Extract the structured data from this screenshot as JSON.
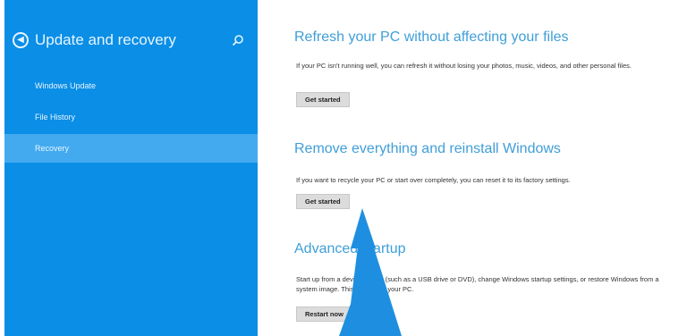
{
  "sidebar": {
    "title": "Update and recovery",
    "back_icon": "back-arrow-circle-icon",
    "search_icon": "search-icon",
    "items": [
      {
        "label": "Windows Update",
        "selected": false
      },
      {
        "label": "File History",
        "selected": false
      },
      {
        "label": "Recovery",
        "selected": true
      }
    ],
    "background_color": "#0a8ee6",
    "selected_color": "#43aaf0"
  },
  "main": {
    "sections": [
      {
        "title": "Refresh your PC without affecting your files",
        "description": "If your PC isn't running well, you can refresh it without losing your photos, music, videos, and other personal files.",
        "button_label": "Get started"
      },
      {
        "title": "Remove everything and reinstall Windows",
        "description": "If you want to recycle your PC or start over completely, you can reset it to its factory settings.",
        "button_label": "Get started"
      },
      {
        "title": "Advanced startup",
        "description": "Start up from a device or disc (such as a USB drive or DVD), change Windows startup settings, or restore Windows from a system image. This will restart your PC.",
        "button_label": "Restart now"
      }
    ],
    "heading_color": "#3f9fd8"
  },
  "annotation": {
    "arrow_color": "#1e8fe0"
  }
}
